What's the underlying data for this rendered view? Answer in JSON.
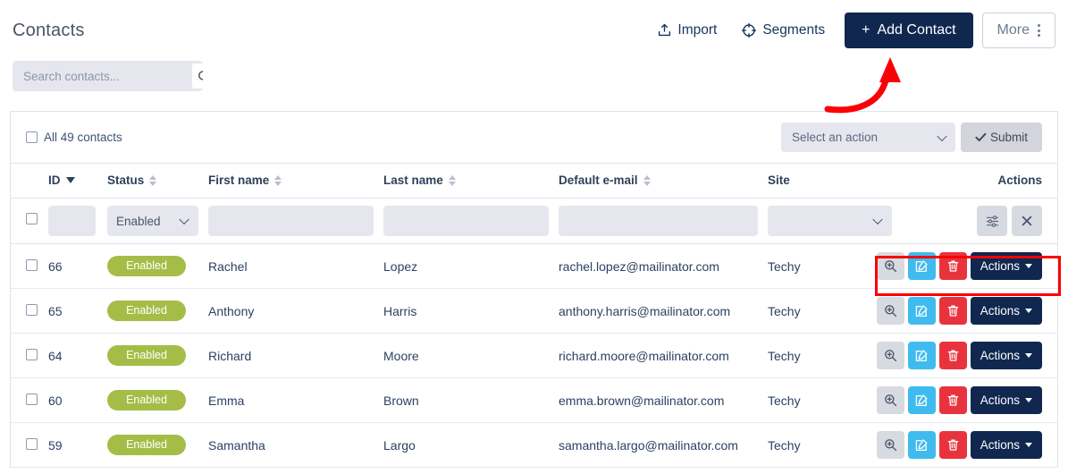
{
  "header": {
    "title": "Contacts",
    "import_label": "Import",
    "import_icon": "upload-icon",
    "segments_label": "Segments",
    "segments_icon": "crosshair-icon",
    "add_contact_label": "Add Contact",
    "add_contact_plus": "+",
    "more_label": "More",
    "more_icon": "kebab-vertical-icon",
    "primary_color": "#10274f"
  },
  "search": {
    "placeholder": "Search contacts...",
    "value": "",
    "button_icon": "search-icon"
  },
  "bulkbar": {
    "select_all_label": "All 49 contacts",
    "select_all_checked": false,
    "action_select_value": "Select an action",
    "submit_label": "Submit",
    "submit_icon": "check-icon"
  },
  "table": {
    "columns": [
      {
        "key": "checkbox",
        "label": "",
        "sort": "none"
      },
      {
        "key": "id",
        "label": "ID",
        "sort": "desc"
      },
      {
        "key": "status",
        "label": "Status",
        "sort": "both"
      },
      {
        "key": "first_name",
        "label": "First name",
        "sort": "both"
      },
      {
        "key": "last_name",
        "label": "Last name",
        "sort": "both"
      },
      {
        "key": "email",
        "label": "Default e-mail",
        "sort": "both"
      },
      {
        "key": "site",
        "label": "Site",
        "sort": "none"
      },
      {
        "key": "actions",
        "label": "Actions",
        "sort": "none"
      }
    ],
    "filters": {
      "id": "",
      "id_placeholder": "",
      "status": "Enabled",
      "first_name": "",
      "last_name": "",
      "email": "",
      "site": "",
      "filter_icon": "sliders-icon",
      "clear_icon": "close-icon"
    },
    "rows": [
      {
        "id": "66",
        "status": "Enabled",
        "first_name": "Rachel",
        "last_name": "Lopez",
        "email": "rachel.lopez@mailinator.com",
        "site": "Techy",
        "actions_label": "Actions"
      },
      {
        "id": "65",
        "status": "Enabled",
        "first_name": "Anthony",
        "last_name": "Harris",
        "email": "anthony.harris@mailinator.com",
        "site": "Techy",
        "actions_label": "Actions"
      },
      {
        "id": "64",
        "status": "Enabled",
        "first_name": "Richard",
        "last_name": "Moore",
        "email": "richard.moore@mailinator.com",
        "site": "Techy",
        "actions_label": "Actions"
      },
      {
        "id": "60",
        "status": "Enabled",
        "first_name": "Emma",
        "last_name": "Brown",
        "email": "emma.brown@mailinator.com",
        "site": "Techy",
        "actions_label": "Actions"
      },
      {
        "id": "59",
        "status": "Enabled",
        "first_name": "Samantha",
        "last_name": "Largo",
        "email": "samantha.largo@mailinator.com",
        "site": "Techy",
        "actions_label": "Actions"
      }
    ],
    "row_action_icons": {
      "view": "zoom-in-icon",
      "edit": "edit-pencil-icon",
      "delete": "trash-icon",
      "dropdown": "caret-down-icon"
    },
    "status_badge_color": "#a5bd47"
  },
  "annotations": {
    "highlight_color": "#fb0007",
    "arrow_target": "add-contact-button",
    "box_target": "row-actions-group"
  }
}
